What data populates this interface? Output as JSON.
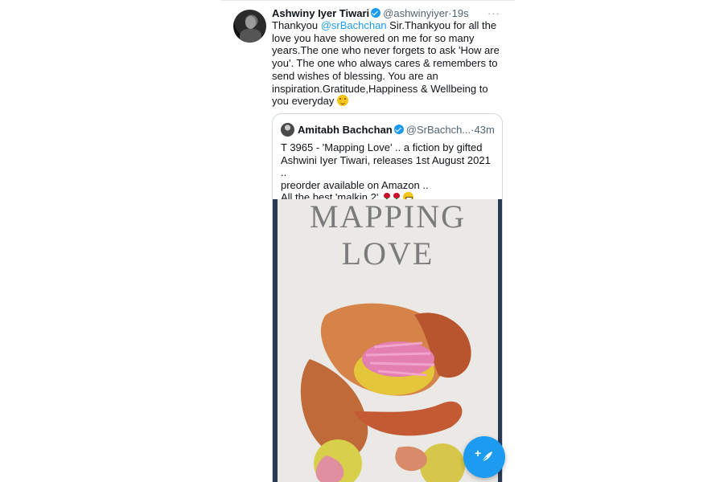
{
  "tweet": {
    "author_name": "Ashwiny Iyer Tiwari",
    "handle": "@ashwinyiyer",
    "time": "19s",
    "more": "···",
    "text_part1": "Thankyou ",
    "mention": "@srBachchan",
    "text_part2": " Sir.Thankyou for all the love you have showered on me for so many years.The one who never forgets to ask 'How are you'. The one who always cares & remembers to send wishes of blessing. You are an inspiration.Gratitude,Happiness & Wellbeing to you everyday ",
    "emoji": "hugging-face-emoji"
  },
  "quoted_tweet": {
    "author_name": "Amitabh Bachchan",
    "handle": "@SrBachch...",
    "time": "43m",
    "separator": "·",
    "line1": "T 3965 - 'Mapping Love' .. a fiction by gifted",
    "line2": "Ashwini Iyer Tiwari, releases 1st August 2021 ..",
    "line3": "preorder available on Amazon ..",
    "line4": "All the best 'malkin 2'",
    "emojis": [
      "rose-emoji",
      "rose-emoji",
      "grinning-face-emoji"
    ]
  },
  "media": {
    "book_title_line1": "MAPPING",
    "book_title_line2": "LOVE"
  },
  "compose_button": {
    "icon": "compose-feather-icon",
    "color": "#1d9bf0"
  },
  "colors": {
    "link": "#1d9bf0",
    "verified": "#1d9bf0",
    "muted_text": "#536471"
  }
}
